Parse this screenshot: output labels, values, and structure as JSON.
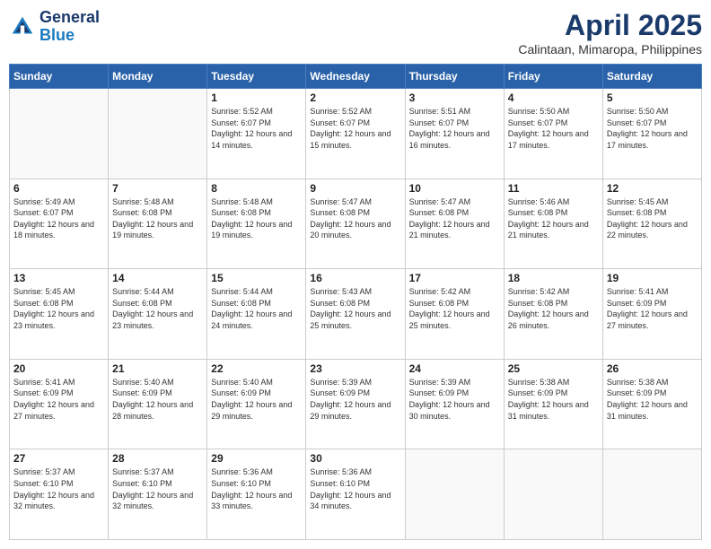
{
  "header": {
    "logo_line1": "General",
    "logo_line2": "Blue",
    "title": "April 2025",
    "subtitle": "Calintaan, Mimaropa, Philippines"
  },
  "days_of_week": [
    "Sunday",
    "Monday",
    "Tuesday",
    "Wednesday",
    "Thursday",
    "Friday",
    "Saturday"
  ],
  "weeks": [
    [
      {
        "day": "",
        "info": ""
      },
      {
        "day": "",
        "info": ""
      },
      {
        "day": "1",
        "info": "Sunrise: 5:52 AM\nSunset: 6:07 PM\nDaylight: 12 hours and 14 minutes."
      },
      {
        "day": "2",
        "info": "Sunrise: 5:52 AM\nSunset: 6:07 PM\nDaylight: 12 hours and 15 minutes."
      },
      {
        "day": "3",
        "info": "Sunrise: 5:51 AM\nSunset: 6:07 PM\nDaylight: 12 hours and 16 minutes."
      },
      {
        "day": "4",
        "info": "Sunrise: 5:50 AM\nSunset: 6:07 PM\nDaylight: 12 hours and 17 minutes."
      },
      {
        "day": "5",
        "info": "Sunrise: 5:50 AM\nSunset: 6:07 PM\nDaylight: 12 hours and 17 minutes."
      }
    ],
    [
      {
        "day": "6",
        "info": "Sunrise: 5:49 AM\nSunset: 6:07 PM\nDaylight: 12 hours and 18 minutes."
      },
      {
        "day": "7",
        "info": "Sunrise: 5:48 AM\nSunset: 6:08 PM\nDaylight: 12 hours and 19 minutes."
      },
      {
        "day": "8",
        "info": "Sunrise: 5:48 AM\nSunset: 6:08 PM\nDaylight: 12 hours and 19 minutes."
      },
      {
        "day": "9",
        "info": "Sunrise: 5:47 AM\nSunset: 6:08 PM\nDaylight: 12 hours and 20 minutes."
      },
      {
        "day": "10",
        "info": "Sunrise: 5:47 AM\nSunset: 6:08 PM\nDaylight: 12 hours and 21 minutes."
      },
      {
        "day": "11",
        "info": "Sunrise: 5:46 AM\nSunset: 6:08 PM\nDaylight: 12 hours and 21 minutes."
      },
      {
        "day": "12",
        "info": "Sunrise: 5:45 AM\nSunset: 6:08 PM\nDaylight: 12 hours and 22 minutes."
      }
    ],
    [
      {
        "day": "13",
        "info": "Sunrise: 5:45 AM\nSunset: 6:08 PM\nDaylight: 12 hours and 23 minutes."
      },
      {
        "day": "14",
        "info": "Sunrise: 5:44 AM\nSunset: 6:08 PM\nDaylight: 12 hours and 23 minutes."
      },
      {
        "day": "15",
        "info": "Sunrise: 5:44 AM\nSunset: 6:08 PM\nDaylight: 12 hours and 24 minutes."
      },
      {
        "day": "16",
        "info": "Sunrise: 5:43 AM\nSunset: 6:08 PM\nDaylight: 12 hours and 25 minutes."
      },
      {
        "day": "17",
        "info": "Sunrise: 5:42 AM\nSunset: 6:08 PM\nDaylight: 12 hours and 25 minutes."
      },
      {
        "day": "18",
        "info": "Sunrise: 5:42 AM\nSunset: 6:08 PM\nDaylight: 12 hours and 26 minutes."
      },
      {
        "day": "19",
        "info": "Sunrise: 5:41 AM\nSunset: 6:09 PM\nDaylight: 12 hours and 27 minutes."
      }
    ],
    [
      {
        "day": "20",
        "info": "Sunrise: 5:41 AM\nSunset: 6:09 PM\nDaylight: 12 hours and 27 minutes."
      },
      {
        "day": "21",
        "info": "Sunrise: 5:40 AM\nSunset: 6:09 PM\nDaylight: 12 hours and 28 minutes."
      },
      {
        "day": "22",
        "info": "Sunrise: 5:40 AM\nSunset: 6:09 PM\nDaylight: 12 hours and 29 minutes."
      },
      {
        "day": "23",
        "info": "Sunrise: 5:39 AM\nSunset: 6:09 PM\nDaylight: 12 hours and 29 minutes."
      },
      {
        "day": "24",
        "info": "Sunrise: 5:39 AM\nSunset: 6:09 PM\nDaylight: 12 hours and 30 minutes."
      },
      {
        "day": "25",
        "info": "Sunrise: 5:38 AM\nSunset: 6:09 PM\nDaylight: 12 hours and 31 minutes."
      },
      {
        "day": "26",
        "info": "Sunrise: 5:38 AM\nSunset: 6:09 PM\nDaylight: 12 hours and 31 minutes."
      }
    ],
    [
      {
        "day": "27",
        "info": "Sunrise: 5:37 AM\nSunset: 6:10 PM\nDaylight: 12 hours and 32 minutes."
      },
      {
        "day": "28",
        "info": "Sunrise: 5:37 AM\nSunset: 6:10 PM\nDaylight: 12 hours and 32 minutes."
      },
      {
        "day": "29",
        "info": "Sunrise: 5:36 AM\nSunset: 6:10 PM\nDaylight: 12 hours and 33 minutes."
      },
      {
        "day": "30",
        "info": "Sunrise: 5:36 AM\nSunset: 6:10 PM\nDaylight: 12 hours and 34 minutes."
      },
      {
        "day": "",
        "info": ""
      },
      {
        "day": "",
        "info": ""
      },
      {
        "day": "",
        "info": ""
      }
    ]
  ]
}
